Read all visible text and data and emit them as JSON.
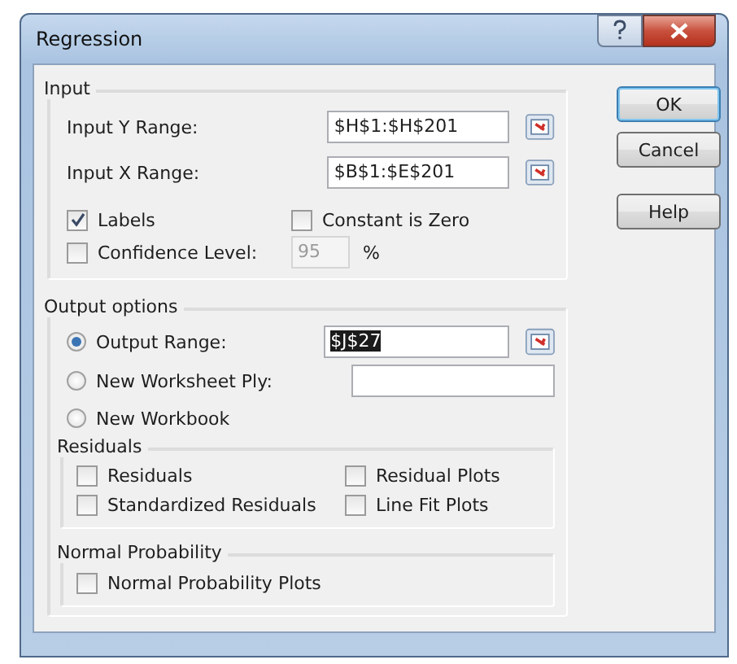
{
  "window": {
    "title": "Regression"
  },
  "input": {
    "title": "Input",
    "ranges": [
      {
        "label": "Input Y Range:",
        "value": "$H$1:$H$201"
      },
      {
        "label": "Input X Range:",
        "value": "$B$1:$E$201"
      }
    ],
    "labels": {
      "label": "Labels",
      "checked": true
    },
    "constant_zero": {
      "label": "Constant is Zero",
      "checked": false
    },
    "confidence": {
      "label": "Confidence Level:",
      "checked": false,
      "value": "95",
      "unit": "%",
      "disabled": true
    }
  },
  "output": {
    "title": "Output options",
    "choices": [
      {
        "kind": "range",
        "label": "Output Range:",
        "selected": true,
        "value": "$J$27",
        "text_selected": true
      },
      {
        "kind": "field",
        "label": "New Worksheet Ply:",
        "selected": false
      },
      {
        "kind": "plain",
        "label": "New Workbook",
        "selected": false
      }
    ]
  },
  "residuals": {
    "title": "Residuals",
    "options": [
      {
        "label": "Residuals",
        "checked": false
      },
      {
        "label": "Residual Plots",
        "checked": false
      },
      {
        "label": "Standardized Residuals",
        "checked": false
      },
      {
        "label": "Line Fit Plots",
        "checked": false
      }
    ]
  },
  "normal_probability": {
    "title": "Normal Probability",
    "options": [
      {
        "label": "Normal Probability Plots",
        "checked": false
      }
    ]
  },
  "buttons": [
    {
      "label": "OK",
      "default": true
    },
    {
      "label": "Cancel",
      "default": false
    },
    {
      "label": "Help",
      "default": false
    }
  ]
}
